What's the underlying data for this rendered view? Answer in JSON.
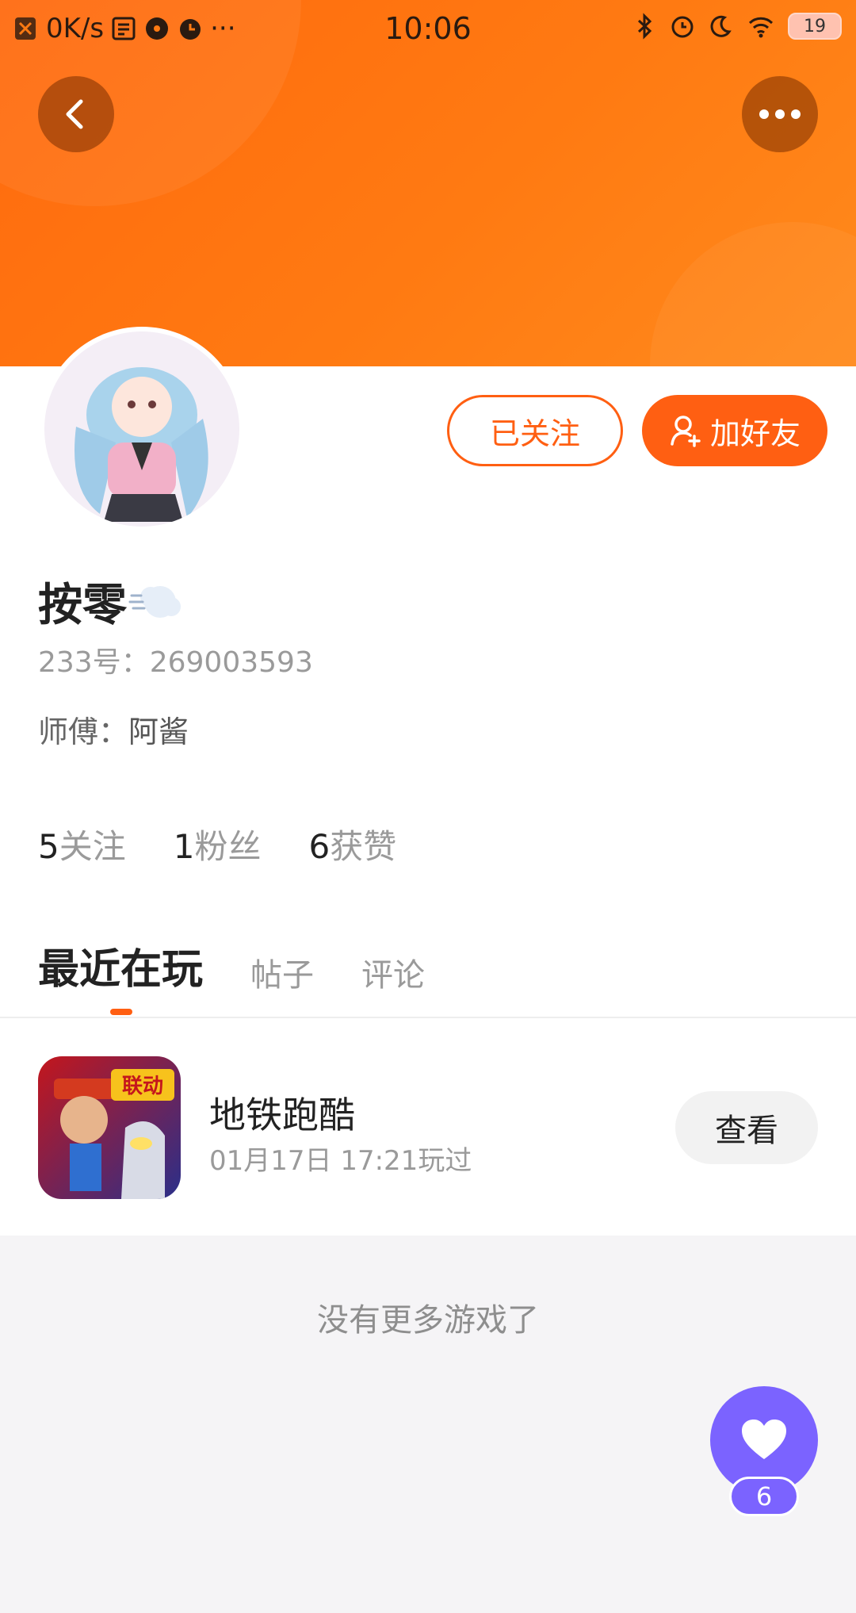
{
  "status_bar": {
    "network_speed": "0K/s",
    "time": "10:06",
    "battery": "19",
    "dots": "···"
  },
  "header": {
    "back_icon": "chevron-left-icon",
    "more_icon": "more-dots-icon"
  },
  "profile": {
    "followed_button": "已关注",
    "add_friend_button": "加好友",
    "username": "按零",
    "uid": "233号：269003593",
    "mentor_label": "师傅：",
    "mentor_value": "阿酱",
    "stats": [
      {
        "num": "5",
        "label": "关注"
      },
      {
        "num": "1",
        "label": "粉丝"
      },
      {
        "num": "6",
        "label": "获赞"
      }
    ]
  },
  "tabs": [
    {
      "label": "最近在玩",
      "active": true
    },
    {
      "label": "帖子",
      "active": false
    },
    {
      "label": "评论",
      "active": false
    }
  ],
  "games": [
    {
      "title": "地铁跑酷",
      "played_time": "01月17日 17:21玩过",
      "action": "查看",
      "badge": "联动"
    }
  ],
  "footer": {
    "no_more_text": "没有更多游戏了",
    "like_count": "6"
  },
  "colors": {
    "accent": "#ff5f12",
    "banner": "#ff7a12",
    "fab": "#7b63ff"
  }
}
